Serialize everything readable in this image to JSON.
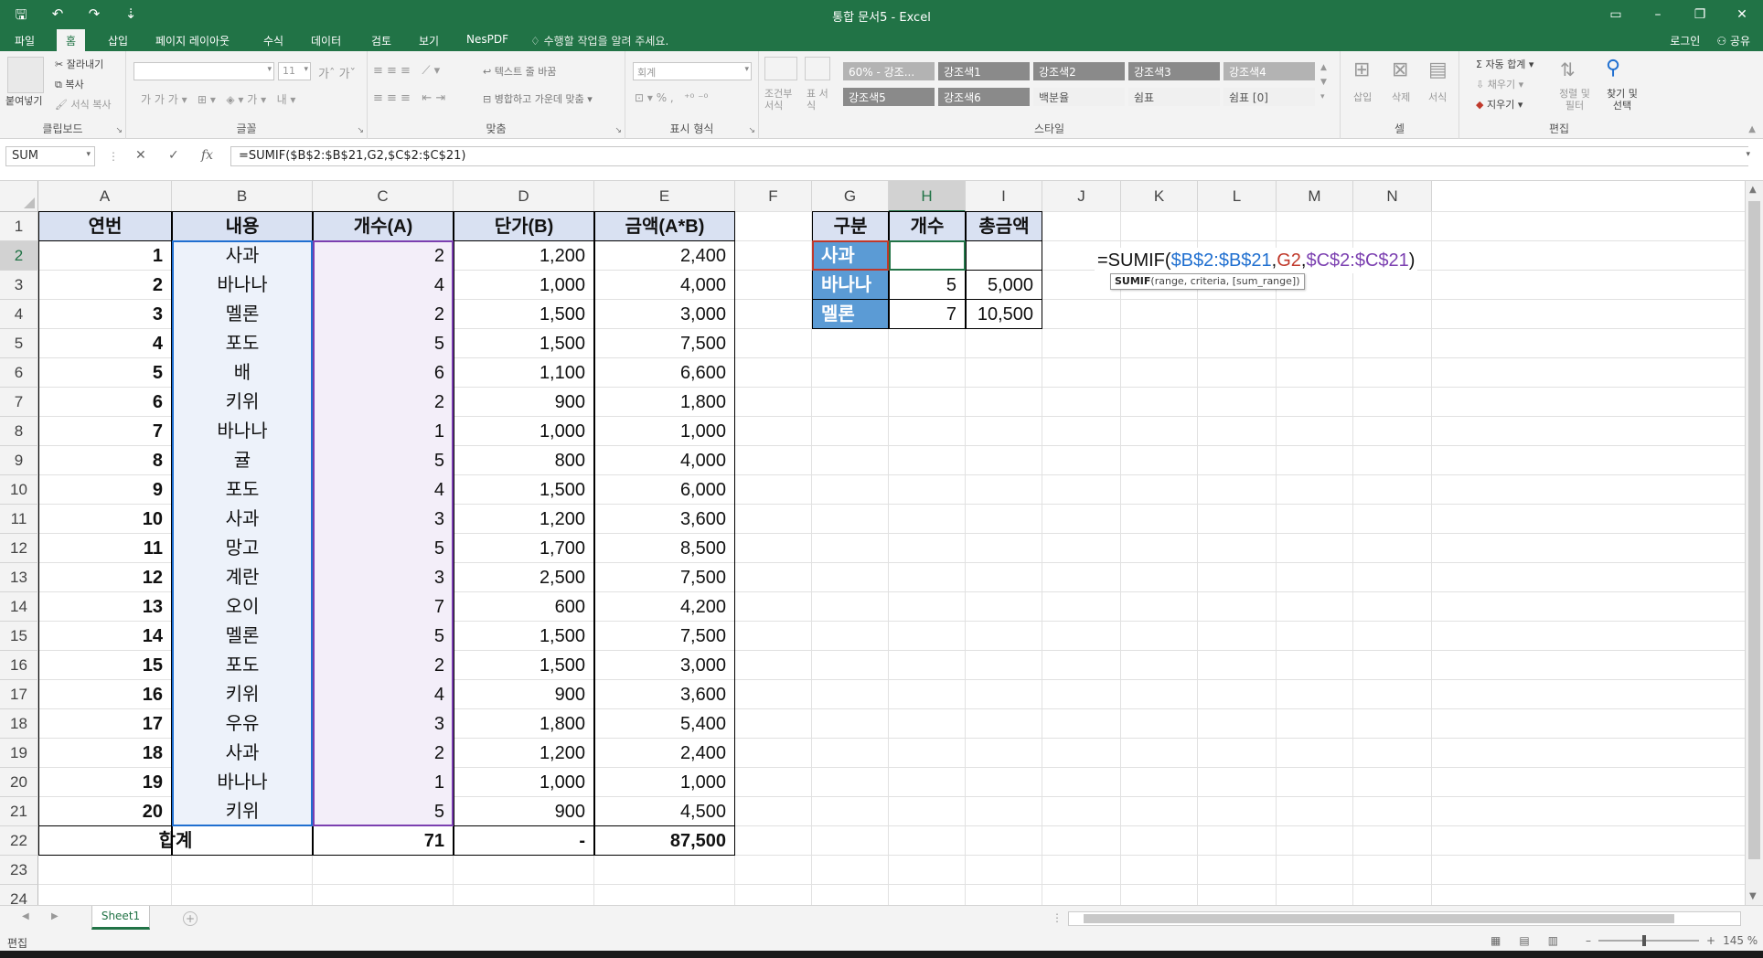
{
  "window": {
    "title": "통합 문서5 - Excel"
  },
  "tabs": {
    "file": "파일",
    "home": "홈",
    "insert": "삽입",
    "layout": "페이지 레이아웃",
    "formulas": "수식",
    "data": "데이터",
    "review": "검토",
    "view": "보기",
    "nespdf": "NesPDF",
    "tell_me": "수행할 작업을 알려 주세요.",
    "login": "로그인",
    "share": "공유"
  },
  "ribbon": {
    "clipboard": {
      "label": "클립보드",
      "paste": "붙여넣기",
      "cut": "잘라내기",
      "copy": "복사",
      "format_painter": "서식 복사"
    },
    "font": {
      "label": "글꼴",
      "size": "11"
    },
    "align": {
      "label": "맞춤",
      "wrap": "텍스트 줄 바꿈",
      "merge": "병합하고 가운데 맞춤"
    },
    "number": {
      "label": "표시 형식",
      "format": "회계"
    },
    "styles": {
      "label": "스타일",
      "conditional": "조건부 서식",
      "table": "표 서식",
      "cells": [
        "60% - 강조...",
        "강조색1",
        "강조색2",
        "강조색3",
        "강조색4",
        "강조색5",
        "강조색6",
        "백분율",
        "쉼표",
        "쉼표 [0]"
      ]
    },
    "cells": {
      "label": "셀",
      "insert": "삽입",
      "delete": "삭제",
      "format": "서식"
    },
    "editing": {
      "label": "편집",
      "autosum": "자동 합계",
      "fill": "채우기",
      "clear": "지우기",
      "sort": "정렬 및 필터",
      "find": "찾기 및 선택"
    }
  },
  "formula_bar": {
    "name_box": "SUM",
    "formula": "=SUMIF($B$2:$B$21,G2,$C$2:$C$21)"
  },
  "columns": [
    "A",
    "B",
    "C",
    "D",
    "E",
    "F",
    "G",
    "H",
    "I",
    "J",
    "K",
    "L",
    "M",
    "N"
  ],
  "rows": [
    "1",
    "2",
    "3",
    "4",
    "5",
    "6",
    "7",
    "8",
    "9",
    "10",
    "11",
    "12",
    "13",
    "14",
    "15",
    "16",
    "17",
    "18",
    "19",
    "20",
    "21",
    "22",
    "23",
    "24"
  ],
  "table": {
    "headers": [
      "연번",
      "내용",
      "개수(A)",
      "단가(B)",
      "금액(A*B)"
    ],
    "rows": [
      [
        "1",
        "사과",
        "2",
        "1,200",
        "2,400"
      ],
      [
        "2",
        "바나나",
        "4",
        "1,000",
        "4,000"
      ],
      [
        "3",
        "멜론",
        "2",
        "1,500",
        "3,000"
      ],
      [
        "4",
        "포도",
        "5",
        "1,500",
        "7,500"
      ],
      [
        "5",
        "배",
        "6",
        "1,100",
        "6,600"
      ],
      [
        "6",
        "키위",
        "2",
        "900",
        "1,800"
      ],
      [
        "7",
        "바나나",
        "1",
        "1,000",
        "1,000"
      ],
      [
        "8",
        "귤",
        "5",
        "800",
        "4,000"
      ],
      [
        "9",
        "포도",
        "4",
        "1,500",
        "6,000"
      ],
      [
        "10",
        "사과",
        "3",
        "1,200",
        "3,600"
      ],
      [
        "11",
        "망고",
        "5",
        "1,700",
        "8,500"
      ],
      [
        "12",
        "계란",
        "3",
        "2,500",
        "7,500"
      ],
      [
        "13",
        "오이",
        "7",
        "600",
        "4,200"
      ],
      [
        "14",
        "멜론",
        "5",
        "1,500",
        "7,500"
      ],
      [
        "15",
        "포도",
        "2",
        "1,500",
        "3,000"
      ],
      [
        "16",
        "키위",
        "4",
        "900",
        "3,600"
      ],
      [
        "17",
        "우유",
        "3",
        "1,800",
        "5,400"
      ],
      [
        "18",
        "사과",
        "2",
        "1,200",
        "2,400"
      ],
      [
        "19",
        "바나나",
        "1",
        "1,000",
        "1,000"
      ],
      [
        "20",
        "키위",
        "5",
        "900",
        "4,500"
      ]
    ],
    "total": {
      "label": "합계",
      "count": "71",
      "price": "-",
      "amount": "87,500"
    }
  },
  "summary": {
    "headers": [
      "구분",
      "개수",
      "총금액"
    ],
    "rows": [
      [
        "사과",
        "",
        ""
      ],
      [
        "바나나",
        "5",
        "5,000"
      ],
      [
        "멜론",
        "7",
        "10,500"
      ]
    ]
  },
  "editing": {
    "prefix": "=SUMIF(",
    "ref1": "$B$2:$B$21",
    "sep1": ",",
    "ref2": "G2",
    "sep2": ",",
    "ref3": "$C$2:$C$21",
    "suffix": ")",
    "tooltip_fn": "SUMIF",
    "tooltip_args": "(range, criteria, [sum_range])"
  },
  "sheets": {
    "active": "Sheet1"
  },
  "status": {
    "mode": "편집",
    "zoom": "145 %"
  },
  "colors": {
    "accent": "#217346",
    "header_fill": "#d9e1f2",
    "summary_fill": "#5b9bd5",
    "range1": "#1f6fd0",
    "range2": "#c0392b",
    "range3": "#7b3fb0"
  }
}
